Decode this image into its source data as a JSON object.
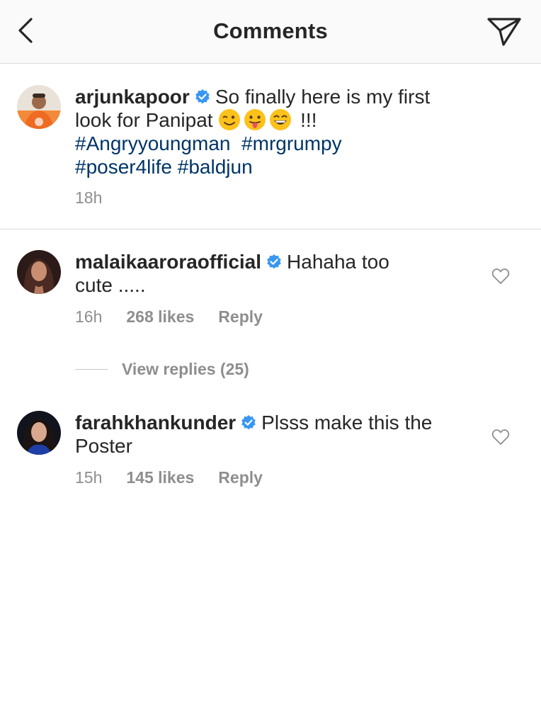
{
  "header": {
    "title": "Comments"
  },
  "caption": {
    "username": "arjunkapoor",
    "text": "So finally here is my first look for Panipat",
    "emojis": [
      "winking-face",
      "face-with-tongue",
      "grinning-face"
    ],
    "exclaim": "!!!",
    "hashtags": [
      "#Angryyoungman",
      "#mrgrumpy",
      "#poser4life",
      "#baldjun"
    ],
    "time": "18h"
  },
  "comments": [
    {
      "username": "malaikaaroraofficial",
      "text_line1": "Hahaha too",
      "text_line2": "cute .....",
      "time": "16h",
      "likes": "268 likes",
      "reply_label": "Reply",
      "view_replies": "View replies (25)"
    },
    {
      "username": "farahkhankunder",
      "text_line1": "Plsss make this the",
      "text_line2": "Poster",
      "time": "15h",
      "likes": "145 likes",
      "reply_label": "Reply"
    }
  ],
  "colors": {
    "hashtag": "#003569",
    "verified": "#3897f0",
    "muted": "#8e8e8e",
    "text": "#262626",
    "divider": "#dbdbdb"
  }
}
